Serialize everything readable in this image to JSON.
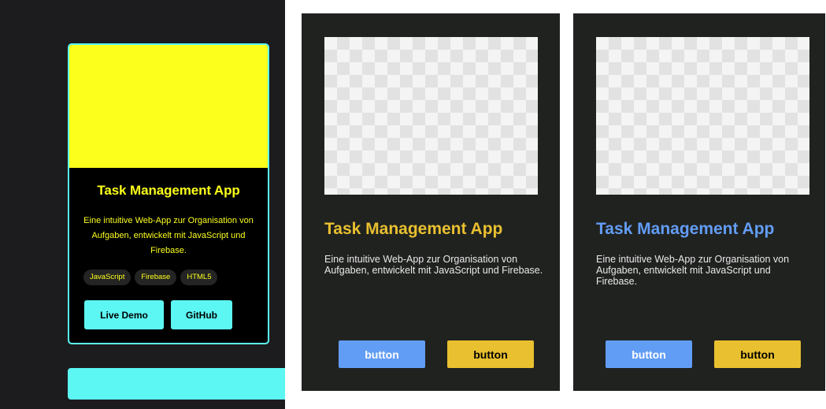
{
  "panel1": {
    "title": "Task Management App",
    "description": "Eine intuitive Web-App zur Organisation von Aufgaben, entwickelt mit JavaScript und Firebase.",
    "tags": [
      "JavaScript",
      "Firebase",
      "HTML5"
    ],
    "buttons": {
      "live_demo": "Live Demo",
      "github": "GitHub"
    },
    "colors": {
      "background": "#1c1c1e",
      "accent": "#5cf6f3",
      "highlight": "#fcff1b"
    }
  },
  "panel2": {
    "title": "Task Management App",
    "description": "Eine intuitive Web-App zur Organisation von Aufgaben, entwickelt mit JavaScript und Firebase.",
    "buttons": {
      "primary": "button",
      "secondary": "button"
    },
    "colors": {
      "title": "#e9c02f",
      "primary_button": "#629df5",
      "secondary_button": "#e9c02f"
    }
  },
  "panel3": {
    "title": "Task Management App",
    "description": "Eine intuitive Web-App zur Organisation von Aufgaben, entwickelt mit JavaScript und Firebase.",
    "buttons": {
      "primary": "button",
      "secondary": "button"
    },
    "colors": {
      "title": "#629df5",
      "primary_button": "#629df5",
      "secondary_button": "#e9c02f"
    }
  }
}
